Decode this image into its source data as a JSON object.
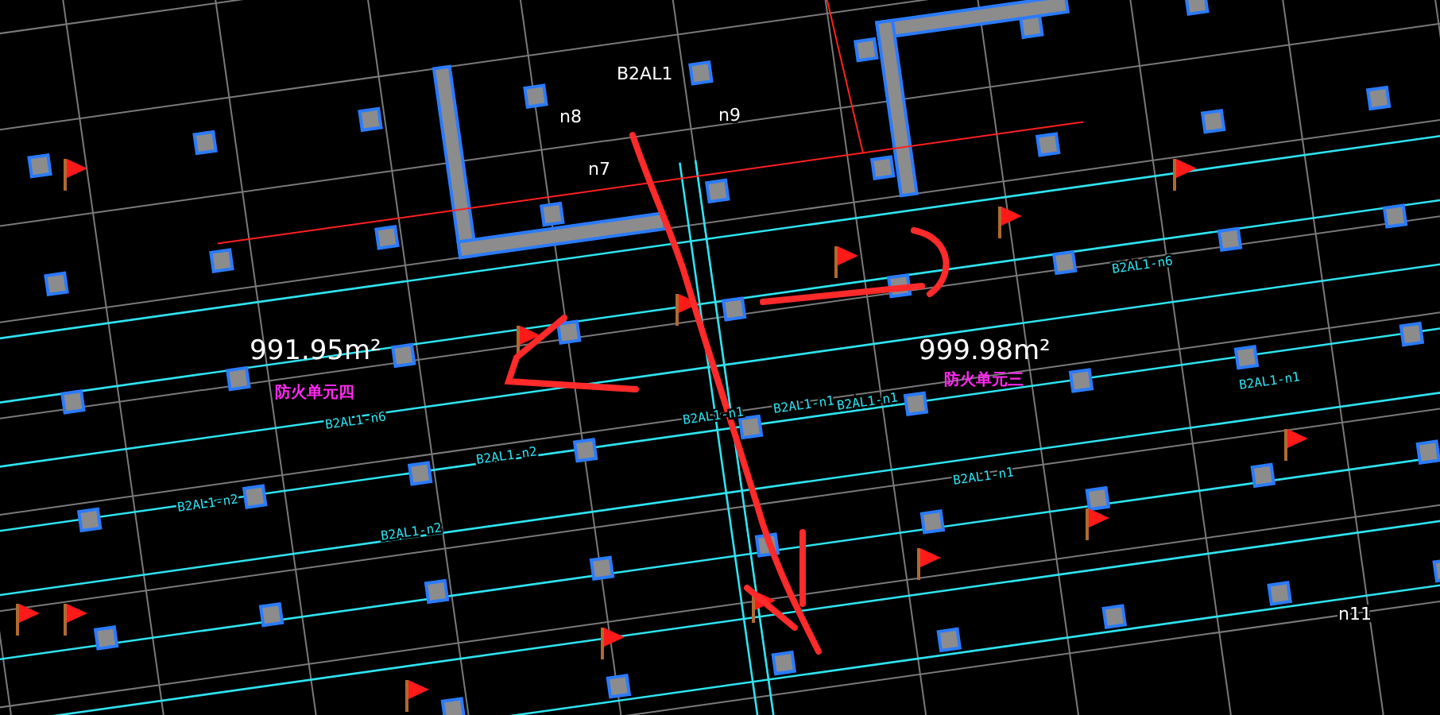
{
  "canvas": {
    "areas": [
      {
        "text": "991.95m²"
      },
      {
        "text": "999.98m²"
      }
    ],
    "zones": [
      {
        "text": "防火单元四"
      },
      {
        "text": "防火单元三"
      }
    ],
    "tags": [
      {
        "text": "B2AL1"
      },
      {
        "text": "n8"
      },
      {
        "text": "n7"
      },
      {
        "text": "n9"
      },
      {
        "text": "n11"
      }
    ],
    "circuits": [
      {
        "text": "B2AL1-n1"
      },
      {
        "text": "B2AL1-n2"
      },
      {
        "text": "B2AL1-n1"
      },
      {
        "text": "B2AL1-n1"
      },
      {
        "text": "B2AL1-n1"
      },
      {
        "text": "B2AL1-n2"
      },
      {
        "text": "B2AL1-n6"
      },
      {
        "text": "B2AL1-n6"
      },
      {
        "text": "B2AL1-n1"
      },
      {
        "text": "B2AL1-n2"
      }
    ]
  }
}
